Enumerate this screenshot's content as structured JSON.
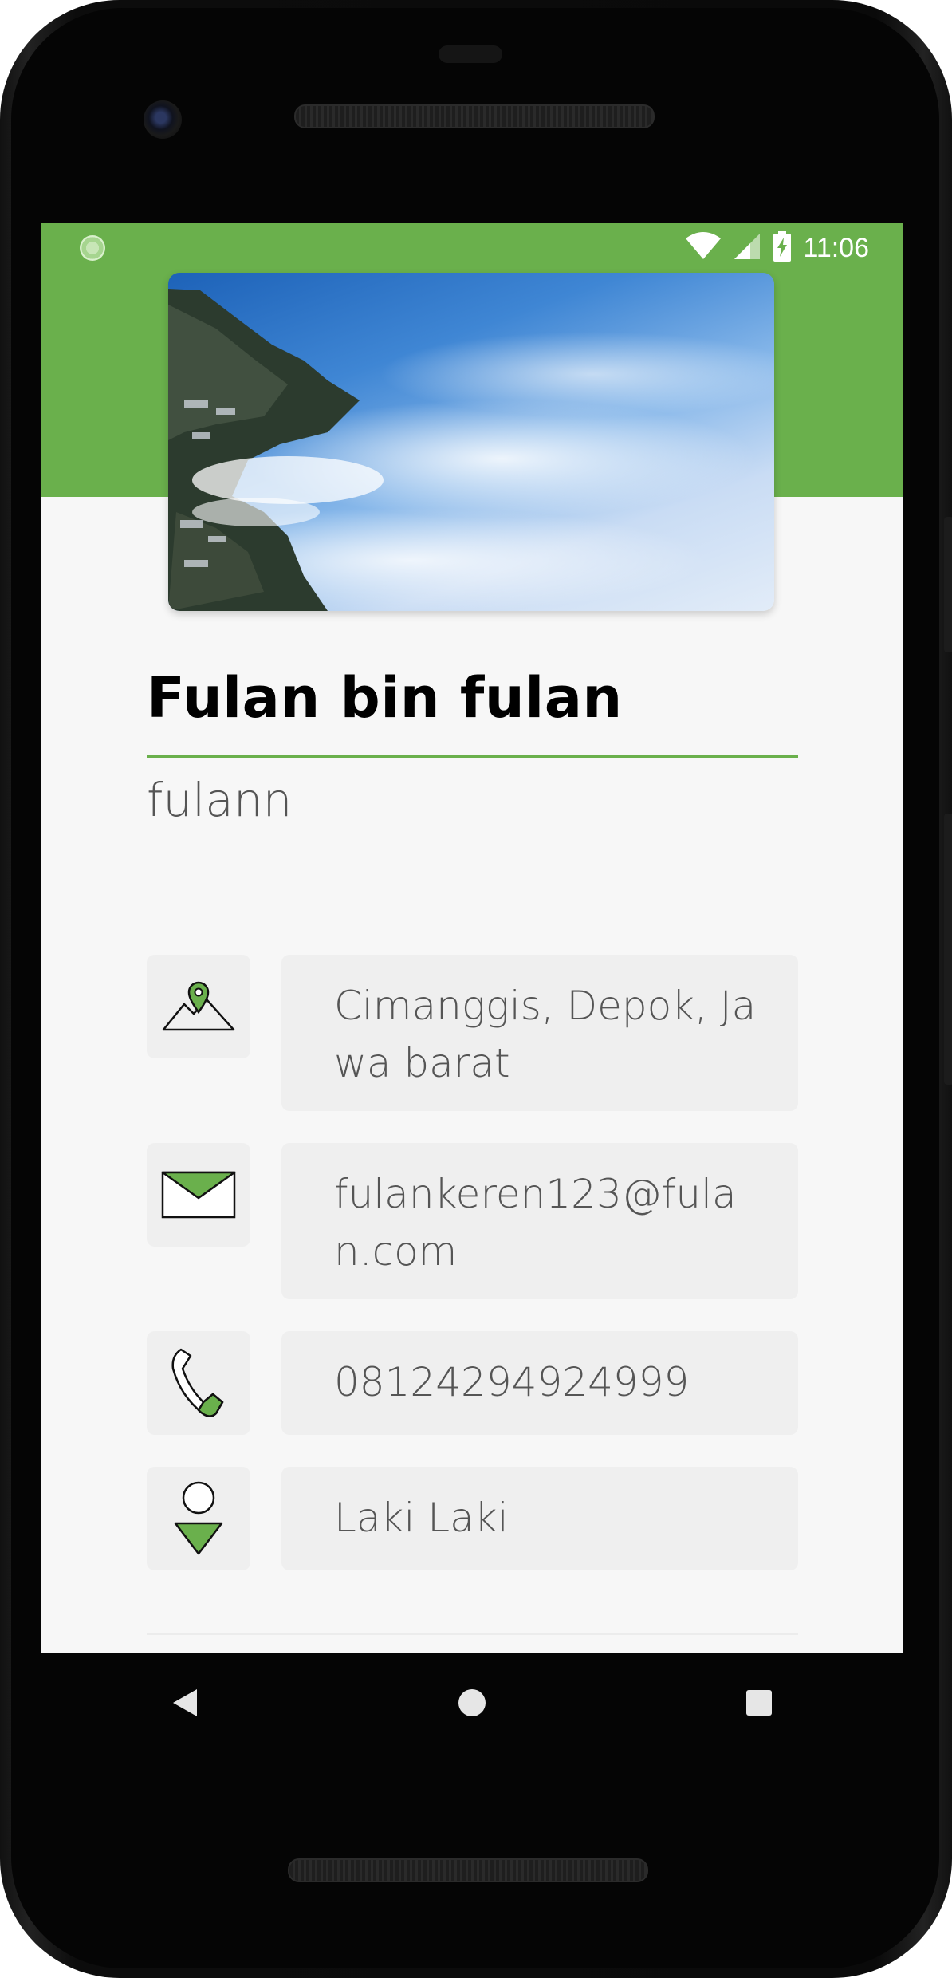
{
  "status_bar": {
    "time": "11:06",
    "icons": [
      "wifi-icon",
      "cell-signal-icon",
      "battery-charging-icon"
    ]
  },
  "colors": {
    "accent": "#6ab04c",
    "card_bg": "#efefef",
    "page_bg": "#f7f7f7"
  },
  "header": {
    "image": "mountain-mist-photo"
  },
  "profile": {
    "name": "Fulan bin fulan",
    "username": "fulann"
  },
  "details": [
    {
      "icon": "map-pin-icon",
      "value": "Cimanggis, Depok, Jawa barat"
    },
    {
      "icon": "mail-icon",
      "value": "fulankeren123@fulan.com"
    },
    {
      "icon": "phone-icon",
      "value": "08124294924999"
    },
    {
      "icon": "gender-icon",
      "value": "Laki Laki"
    }
  ],
  "nav": {
    "items": [
      "back-icon",
      "home-icon",
      "recents-icon"
    ]
  }
}
